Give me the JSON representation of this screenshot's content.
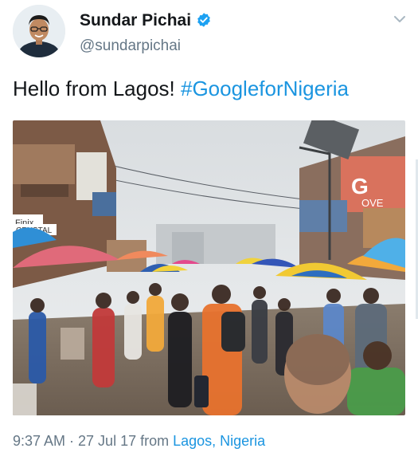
{
  "author": {
    "name": "Sundar Pichai",
    "handle": "@sundarpichai",
    "verified": true,
    "verified_icon": "verified-badge-icon",
    "verified_color": "#1da1f2"
  },
  "menu": {
    "icon": "chevron-down-icon"
  },
  "tweet": {
    "text": "Hello from Lagos! ",
    "hashtag": "#GoogleforNigeria",
    "hashtag_color": "#1b95e0"
  },
  "photo": {
    "signs": {
      "google_banner": "G",
      "google_banner_text": "OVE",
      "shop": "CRYSTAL",
      "shop2": "Finix"
    }
  },
  "footer": {
    "timestamp": "9:37 AM · 27 Jul 17 from ",
    "location": "Lagos, Nigeria"
  },
  "colors": {
    "text": "#14171a",
    "secondary": "#657786",
    "link": "#1b95e0"
  }
}
